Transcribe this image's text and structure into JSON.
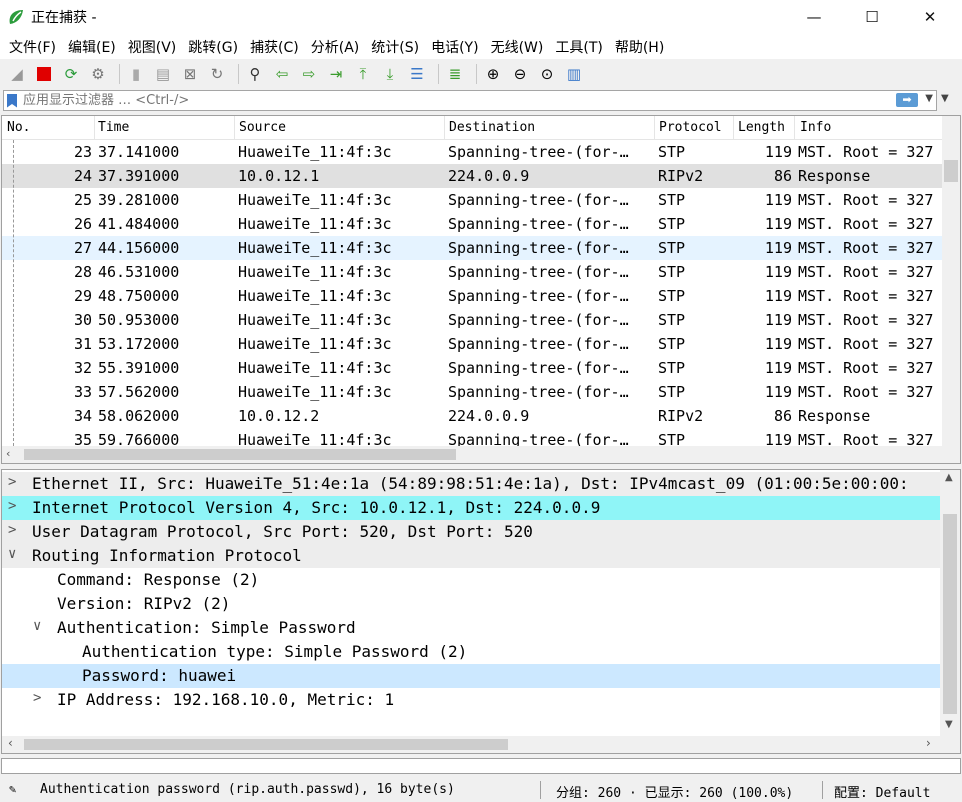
{
  "window": {
    "title": "正在捕获 -"
  },
  "menu": [
    "文件(F)",
    "编辑(E)",
    "视图(V)",
    "跳转(G)",
    "捕获(C)",
    "分析(A)",
    "统计(S)",
    "电话(Y)",
    "无线(W)",
    "工具(T)",
    "帮助(H)"
  ],
  "filter": {
    "placeholder": "应用显示过滤器 … <Ctrl-/>"
  },
  "packet_list": {
    "columns": [
      "No.",
      "Time",
      "Source",
      "Destination",
      "Protocol",
      "Length",
      "Info"
    ],
    "rows": [
      {
        "no": "23",
        "time": "37.141000",
        "src": "HuaweiTe_11:4f:3c",
        "dst": "Spanning-tree-(for-…",
        "proto": "STP",
        "len": "119",
        "info": "MST. Root = 327"
      },
      {
        "no": "24",
        "time": "37.391000",
        "src": "10.0.12.1",
        "dst": "224.0.0.9",
        "proto": "RIPv2",
        "len": "86",
        "info": "Response"
      },
      {
        "no": "25",
        "time": "39.281000",
        "src": "HuaweiTe_11:4f:3c",
        "dst": "Spanning-tree-(for-…",
        "proto": "STP",
        "len": "119",
        "info": "MST. Root = 327"
      },
      {
        "no": "26",
        "time": "41.484000",
        "src": "HuaweiTe_11:4f:3c",
        "dst": "Spanning-tree-(for-…",
        "proto": "STP",
        "len": "119",
        "info": "MST. Root = 327"
      },
      {
        "no": "27",
        "time": "44.156000",
        "src": "HuaweiTe_11:4f:3c",
        "dst": "Spanning-tree-(for-…",
        "proto": "STP",
        "len": "119",
        "info": "MST. Root = 327"
      },
      {
        "no": "28",
        "time": "46.531000",
        "src": "HuaweiTe_11:4f:3c",
        "dst": "Spanning-tree-(for-…",
        "proto": "STP",
        "len": "119",
        "info": "MST. Root = 327"
      },
      {
        "no": "29",
        "time": "48.750000",
        "src": "HuaweiTe_11:4f:3c",
        "dst": "Spanning-tree-(for-…",
        "proto": "STP",
        "len": "119",
        "info": "MST. Root = 327"
      },
      {
        "no": "30",
        "time": "50.953000",
        "src": "HuaweiTe_11:4f:3c",
        "dst": "Spanning-tree-(for-…",
        "proto": "STP",
        "len": "119",
        "info": "MST. Root = 327"
      },
      {
        "no": "31",
        "time": "53.172000",
        "src": "HuaweiTe_11:4f:3c",
        "dst": "Spanning-tree-(for-…",
        "proto": "STP",
        "len": "119",
        "info": "MST. Root = 327"
      },
      {
        "no": "32",
        "time": "55.391000",
        "src": "HuaweiTe_11:4f:3c",
        "dst": "Spanning-tree-(for-…",
        "proto": "STP",
        "len": "119",
        "info": "MST. Root = 327"
      },
      {
        "no": "33",
        "time": "57.562000",
        "src": "HuaweiTe_11:4f:3c",
        "dst": "Spanning-tree-(for-…",
        "proto": "STP",
        "len": "119",
        "info": "MST. Root = 327"
      },
      {
        "no": "34",
        "time": "58.062000",
        "src": "10.0.12.2",
        "dst": "224.0.0.9",
        "proto": "RIPv2",
        "len": "86",
        "info": "Response"
      },
      {
        "no": "35",
        "time": "59.766000",
        "src": "HuaweiTe_11:4f:3c",
        "dst": "Spanning-tree-(for-…",
        "proto": "STP",
        "len": "119",
        "info": "MST. Root = 327"
      }
    ]
  },
  "details": [
    {
      "arrow": ">",
      "text": "Ethernet II, Src: HuaweiTe_51:4e:1a (54:89:98:51:4e:1a), Dst: IPv4mcast_09 (01:00:5e:00:00:"
    },
    {
      "arrow": ">",
      "text": "Internet Protocol Version 4, Src: 10.0.12.1, Dst: 224.0.0.9"
    },
    {
      "arrow": ">",
      "text": "User Datagram Protocol, Src Port: 520, Dst Port: 520"
    },
    {
      "arrow": "∨",
      "text": "Routing Information Protocol"
    },
    {
      "arrow": "",
      "text": "Command: Response (2)"
    },
    {
      "arrow": "",
      "text": "Version: RIPv2 (2)"
    },
    {
      "arrow": "∨",
      "text": "Authentication: Simple Password"
    },
    {
      "arrow": "",
      "text": "Authentication type: Simple Password (2)"
    },
    {
      "arrow": "",
      "text": "Password: huawei"
    },
    {
      "arrow": ">",
      "text": "IP Address: 192.168.10.0, Metric: 1"
    }
  ],
  "status": {
    "field": "Authentication password (rip.auth.passwd), 16 byte(s)",
    "packets": "分组: 260 · 已显示: 260 (100.0%)",
    "profile": "配置: Default"
  },
  "colors": {
    "selected_row": "#e0e0e0",
    "hover_row": "#e5f3ff",
    "ip_highlight": "#8ff5f7",
    "detail_selected": "#cce8ff"
  }
}
